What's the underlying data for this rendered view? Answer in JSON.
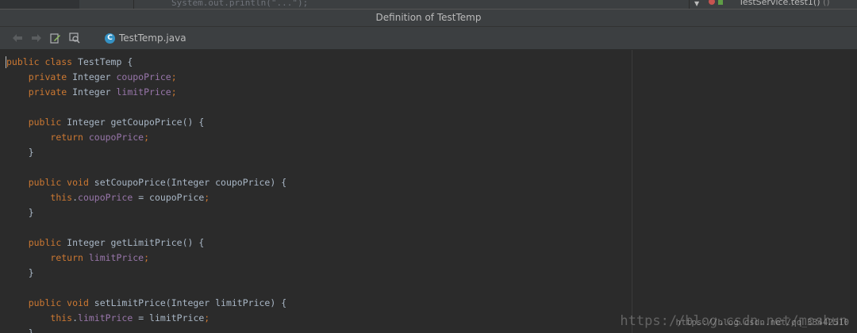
{
  "background": {
    "code_snippet": "System.out.println(\"...\");",
    "method_label": "TestService.test1()",
    "method_suffix": "()"
  },
  "popup": {
    "title": "Definition of TestTemp",
    "toolbar": {
      "back_icon": "back-arrow-icon",
      "forward_icon": "forward-arrow-icon",
      "edit_source_icon": "edit-source-icon",
      "find_usages_icon": "find-usages-icon"
    },
    "file_tab": {
      "icon_letter": "C",
      "file_name": "TestTemp.java"
    }
  },
  "code_lines": [
    [
      {
        "t": "kw",
        "v": "public class "
      },
      {
        "t": "plain",
        "v": "TestTemp {"
      }
    ],
    [
      {
        "t": "plain",
        "v": "    "
      },
      {
        "t": "kw",
        "v": "private "
      },
      {
        "t": "plain",
        "v": "Integer "
      },
      {
        "t": "field",
        "v": "coupoPrice"
      },
      {
        "t": "kw",
        "v": ";"
      }
    ],
    [
      {
        "t": "plain",
        "v": "    "
      },
      {
        "t": "kw",
        "v": "private "
      },
      {
        "t": "plain",
        "v": "Integer "
      },
      {
        "t": "field",
        "v": "limitPrice"
      },
      {
        "t": "kw",
        "v": ";"
      }
    ],
    [],
    [
      {
        "t": "plain",
        "v": "    "
      },
      {
        "t": "kw",
        "v": "public "
      },
      {
        "t": "plain",
        "v": "Integer getCoupoPrice() {"
      }
    ],
    [
      {
        "t": "plain",
        "v": "        "
      },
      {
        "t": "kw",
        "v": "return "
      },
      {
        "t": "field",
        "v": "coupoPrice"
      },
      {
        "t": "kw",
        "v": ";"
      }
    ],
    [
      {
        "t": "plain",
        "v": "    }"
      }
    ],
    [],
    [
      {
        "t": "plain",
        "v": "    "
      },
      {
        "t": "kw",
        "v": "public void "
      },
      {
        "t": "plain",
        "v": "setCoupoPrice(Integer coupoPrice) {"
      }
    ],
    [
      {
        "t": "plain",
        "v": "        "
      },
      {
        "t": "kw",
        "v": "this"
      },
      {
        "t": "plain",
        "v": "."
      },
      {
        "t": "field",
        "v": "coupoPrice"
      },
      {
        "t": "plain",
        "v": " = coupoPrice"
      },
      {
        "t": "kw",
        "v": ";"
      }
    ],
    [
      {
        "t": "plain",
        "v": "    }"
      }
    ],
    [],
    [
      {
        "t": "plain",
        "v": "    "
      },
      {
        "t": "kw",
        "v": "public "
      },
      {
        "t": "plain",
        "v": "Integer getLimitPrice() {"
      }
    ],
    [
      {
        "t": "plain",
        "v": "        "
      },
      {
        "t": "kw",
        "v": "return "
      },
      {
        "t": "field",
        "v": "limitPrice"
      },
      {
        "t": "kw",
        "v": ";"
      }
    ],
    [
      {
        "t": "plain",
        "v": "    }"
      }
    ],
    [],
    [
      {
        "t": "plain",
        "v": "    "
      },
      {
        "t": "kw",
        "v": "public void "
      },
      {
        "t": "plain",
        "v": "setLimitPrice(Integer limitPrice) {"
      }
    ],
    [
      {
        "t": "plain",
        "v": "        "
      },
      {
        "t": "kw",
        "v": "this"
      },
      {
        "t": "plain",
        "v": "."
      },
      {
        "t": "field",
        "v": "limitPrice"
      },
      {
        "t": "plain",
        "v": " = limitPrice"
      },
      {
        "t": "kw",
        "v": ";"
      }
    ],
    [
      {
        "t": "plain",
        "v": "    }"
      }
    ]
  ],
  "watermark": {
    "main": "https://blog.csdn.net/moshun",
    "overlay": "https://blog.csdn.net/qq_33442510"
  },
  "colors": {
    "keyword": "#cc7832",
    "field": "#9876aa",
    "text": "#a9b7c6",
    "background": "#2b2b2b",
    "panel": "#3c3f41",
    "class_icon": "#3592c4"
  }
}
